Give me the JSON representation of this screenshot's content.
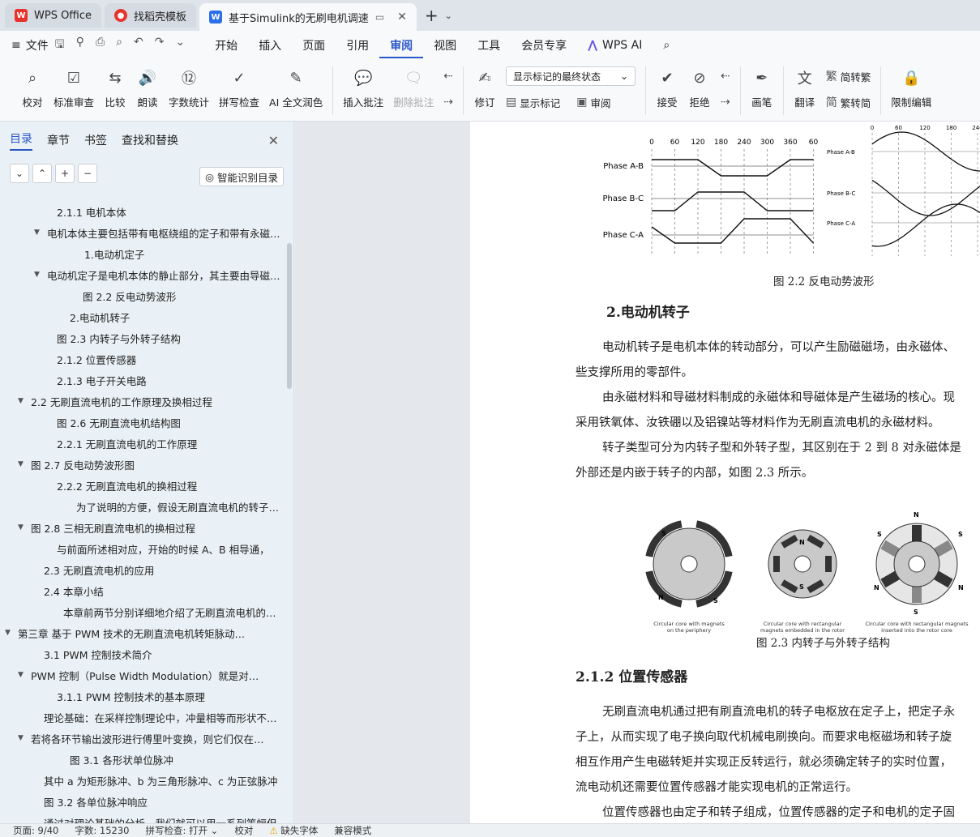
{
  "tabs": [
    {
      "label": "WPS Office",
      "icon": "wps-logo-icon",
      "active": false
    },
    {
      "label": "找稻壳模板",
      "icon": "daoke-icon",
      "active": false
    },
    {
      "label": "基于Simulink的无刷电机调速",
      "icon": "word-doc-icon",
      "active": true
    }
  ],
  "menu": {
    "file": "文件",
    "items": [
      "开始",
      "插入",
      "页面",
      "引用",
      "审阅",
      "视图",
      "工具",
      "会员专享"
    ],
    "active": "审阅",
    "wpsai": "WPS AI"
  },
  "ribbon": {
    "proof": "校对",
    "std_review": "标准审查",
    "compare": "比较",
    "read": "朗读",
    "word_count": "字数统计",
    "spell_check": "拼写检查",
    "ai_polish": "AI 全文润色",
    "insert_comment": "插入批注",
    "delete_comment": "删除批注",
    "track": "修订",
    "markup_select": "显示标记的最终状态",
    "show_markup": "显示标记",
    "review_pane": "审阅",
    "accept": "接受",
    "reject": "拒绝",
    "pen": "画笔",
    "translate": "翻译",
    "to_trad": "简转繁",
    "to_simp": "繁转简",
    "restrict": "限制编辑"
  },
  "nav": {
    "tabs": [
      "目录",
      "章节",
      "书签",
      "查找和替换"
    ],
    "active_tab": "目录",
    "smart_toc": "智能识别目录",
    "toc": [
      {
        "text": "2.1.1  电机本体",
        "indent": 70,
        "caret": ""
      },
      {
        "text": "电机本体主要包括带有电枢绕组的定子和带有永磁体的转子",
        "indent": 58,
        "caret": "▼"
      },
      {
        "text": "1.电动机定子",
        "indent": 104,
        "caret": ""
      },
      {
        "text": "电动机定子是电机本体的静止部分，其主要由导磁的定子铁芯组成",
        "indent": 58,
        "caret": "▼"
      },
      {
        "text": "图 2.2  反电动势波形",
        "indent": 102,
        "caret": ""
      },
      {
        "text": "2.电动机转子",
        "indent": 86,
        "caret": ""
      },
      {
        "text": "图 2.3  内转子与外转子结构",
        "indent": 70,
        "caret": ""
      },
      {
        "text": "2.1.2  位置传感器",
        "indent": 70,
        "caret": ""
      },
      {
        "text": "2.1.3  电子开关电路",
        "indent": 70,
        "caret": ""
      },
      {
        "text": "2.2  无刷直流电机的工作原理及换相过程",
        "indent": 38,
        "caret": "▼"
      },
      {
        "text": "图 2.6  无刷直流电机结构图",
        "indent": 70,
        "caret": ""
      },
      {
        "text": "2.2.1    无刷直流电机的工作原理",
        "indent": 70,
        "caret": ""
      },
      {
        "text": "图 2.7  反电动势波形图",
        "indent": 38,
        "caret": "▼"
      },
      {
        "text": "2.2.2    无刷直流电机的换相过程",
        "indent": 70,
        "caret": ""
      },
      {
        "text": "为了说明的方便，假设无刷直流电机的转子是两极的",
        "indent": 94,
        "caret": ""
      },
      {
        "text": "图 2.8  三相无刷直流电机的换相过程",
        "indent": 38,
        "caret": "▼"
      },
      {
        "text": "与前面所述相对应，开始的时候 A、B 相导通，",
        "indent": 70,
        "caret": ""
      },
      {
        "text": "2.3  无刷直流电机的应用",
        "indent": 54,
        "caret": ""
      },
      {
        "text": "2.4  本章小结",
        "indent": 54,
        "caret": ""
      },
      {
        "text": "本章前两节分别详细地介绍了无刷直流电机的结构组成",
        "indent": 78,
        "caret": ""
      },
      {
        "text": "第三章    基于 PWM 技术的无刷直流电机转矩脉动抑制",
        "indent": 22,
        "caret": "▼"
      },
      {
        "text": "3.1 PWM 控制技术简介",
        "indent": 54,
        "caret": ""
      },
      {
        "text": "PWM 控制（Pulse Width Modulation）就是对脉冲的宽度进行调制",
        "indent": 38,
        "caret": "▼"
      },
      {
        "text": "3.1.1 PWM 控制技术的基本原理",
        "indent": 70,
        "caret": ""
      },
      {
        "text": "理论基础：在采样控制理论中，冲量相等而形状不同的窄脉冲",
        "indent": 54,
        "caret": ""
      },
      {
        "text": "若将各环节输出波形进行傅里叶变换，则它们仅在高频段有差异",
        "indent": 38,
        "caret": "▼"
      },
      {
        "text": "图 3.1  各形状单位脉冲",
        "indent": 86,
        "caret": ""
      },
      {
        "text": "其中 a 为矩形脉冲、b 为三角形脉冲、c 为正弦脉冲",
        "indent": 54,
        "caret": ""
      },
      {
        "text": "图 3.2  各单位脉冲响应",
        "indent": 54,
        "caret": ""
      },
      {
        "text": "通过对理论基础的分析，我们就可以用一系列等幅但",
        "indent": 54,
        "caret": ""
      }
    ]
  },
  "doc": {
    "fig_2_2": {
      "caption": "图 2.2  反电动势波形",
      "angles": [
        "0",
        "60",
        "120",
        "180",
        "240",
        "300",
        "360",
        "60"
      ],
      "angles_right": [
        "0",
        "60",
        "120",
        "180",
        "240",
        "300"
      ],
      "phases": [
        "Phase A-B",
        "Phase B-C",
        "Phase C-A"
      ]
    },
    "heading_rotor": "2.电动机转子",
    "para_rotor": [
      "电动机转子是电机本体的转动部分，可以产生励磁磁场，由永磁体、",
      "些支撑所用的零部件。",
      "由永磁材料和导磁材料制成的永磁体和导磁体是产生磁场的核心。现",
      "采用铁氧体、汝铁硼以及铝镍站等材料作为无刷直流电机的永磁材料。",
      "转子类型可分为内转子型和外转子型，其区别在于 2 到 8 对永磁体是",
      "外部还是内嵌于转子的内部，如图 2.3 所示。"
    ],
    "fig_2_3": {
      "caption": "图 2.3  内转子与外转子结构",
      "sub": [
        [
          "Circular core with magnets",
          "on the periphery"
        ],
        [
          "Circular core with rectangular",
          "magnets embedded in the rotor"
        ],
        [
          "Circular core with rectangular magnets",
          "inserted into the rotor core"
        ]
      ],
      "poles": {
        "n": "N",
        "s": "S"
      }
    },
    "heading_sensor": "2.1.2  位置传感器",
    "para_sensor": [
      "无刷直流电机通过把有刷直流电机的转子电枢放在定子上，把定子永",
      "子上，从而实现了电子换向取代机械电刷换向。而要求电枢磁场和转子旋",
      "相互作用产生电磁转矩并实现正反转运行，就必须确定转子的实时位置，",
      "流电动机还需要位置传感器才能实现电机的正常运行。",
      "位置传感器也由定子和转子组成，位置传感器的定子和电机的定子固"
    ]
  },
  "status": {
    "page": "页面: 9/40",
    "words": "字数: 15230",
    "spell": "拼写检查: 打开",
    "proof": "校对",
    "missing_font": "缺失字体",
    "compat": "兼容模式"
  }
}
